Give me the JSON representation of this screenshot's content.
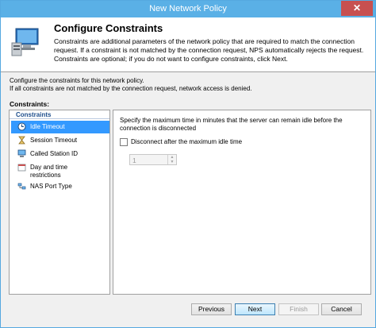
{
  "window": {
    "title": "New Network Policy",
    "close_glyph": "✕"
  },
  "header": {
    "title": "Configure Constraints",
    "description": "Constraints are additional parameters of the network policy that are required to match the connection request. If a constraint is not matched by the connection request, NPS automatically rejects the request. Constraints are optional; if you do not want to configure constraints, click Next."
  },
  "intro": {
    "line1": "Configure the constraints for this network policy.",
    "line2": "If all constraints are not matched by the connection request, network access is denied."
  },
  "constraints_label": "Constraints:",
  "left_panel": {
    "header": "Constraints",
    "items": [
      {
        "label": "Idle Timeout",
        "icon": "clock-icon",
        "selected": true
      },
      {
        "label": "Session Timeout",
        "icon": "hourglass-icon",
        "selected": false
      },
      {
        "label": "Called Station ID",
        "icon": "computer-icon",
        "selected": false
      },
      {
        "label": "Day and time restrictions",
        "icon": "calendar-icon",
        "selected": false
      },
      {
        "label": "NAS Port Type",
        "icon": "network-icon",
        "selected": false
      }
    ]
  },
  "right_panel": {
    "description": "Specify the maximum time in minutes that the server can remain idle before the connection is disconnected",
    "checkbox_label": "Disconnect after the maximum idle time",
    "checkbox_checked": false,
    "spinner_value": "1",
    "spinner_enabled": false
  },
  "buttons": {
    "previous": "Previous",
    "next": "Next",
    "finish": "Finish",
    "cancel": "Cancel"
  },
  "colors": {
    "titlebar": "#5ab0e6",
    "selection": "#3399ff",
    "close": "#c75050"
  }
}
